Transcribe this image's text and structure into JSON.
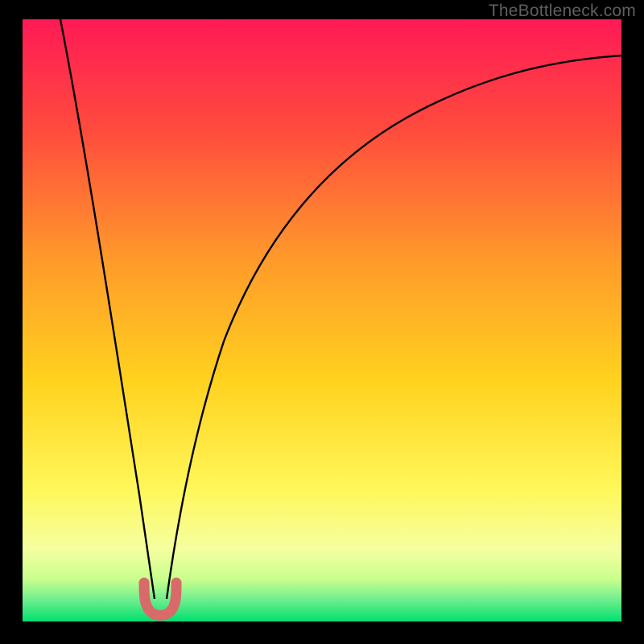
{
  "watermark": "TheBottleneck.com",
  "colors": {
    "bg_black": "#000000",
    "gradient_top": "#ff1a55",
    "gradient_mid1": "#ff7a2a",
    "gradient_mid2": "#ffd21e",
    "gradient_mid3": "#fff75a",
    "gradient_bottom_soft": "#c8ff8c",
    "gradient_bottom": "#00e070",
    "curve": "#000000",
    "marker": "#d86a6a"
  },
  "chart_data": {
    "type": "line",
    "title": "",
    "xlabel": "",
    "ylabel": "",
    "xlim": [
      0,
      100
    ],
    "ylim": [
      0,
      100
    ],
    "annotations": [
      "U-shaped bottleneck curve with minimum near x≈22; small red marker segment at the trough"
    ],
    "series": [
      {
        "name": "bottleneck-curve",
        "x": [
          6,
          8,
          10,
          12,
          14,
          16,
          18,
          20,
          21,
          22,
          23,
          24,
          26,
          28,
          32,
          40,
          50,
          60,
          70,
          80,
          90,
          100
        ],
        "y": [
          100,
          88,
          75,
          62,
          49,
          36,
          23,
          10,
          5,
          2,
          5,
          10,
          22,
          33,
          49,
          67,
          78,
          84,
          88,
          91,
          93,
          94
        ]
      }
    ],
    "markers": [
      {
        "name": "trough-marker",
        "shape": "u",
        "color": "#d86a6a",
        "x_range": [
          20,
          24
        ],
        "y_range": [
          2,
          8
        ]
      }
    ]
  }
}
